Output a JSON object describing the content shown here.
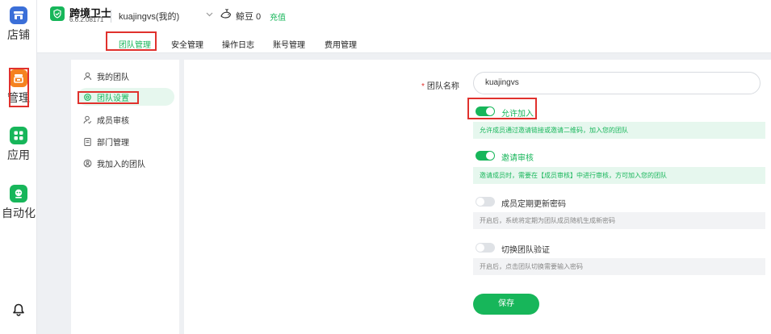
{
  "rail": {
    "items": [
      {
        "label": "店铺",
        "icon": "store-icon"
      },
      {
        "label": "管理",
        "icon": "management-icon"
      },
      {
        "label": "应用",
        "icon": "apps-icon"
      },
      {
        "label": "自动化",
        "icon": "automation-icon"
      }
    ],
    "bottom_icon": "bell-icon"
  },
  "header": {
    "app_name": "跨境卫士",
    "version": "6.6.2.08171",
    "account": "kuajingvs(我的)",
    "beans": "鲸豆 0",
    "recharge": "充值"
  },
  "tabs": [
    "团队管理",
    "安全管理",
    "操作日志",
    "账号管理",
    "费用管理"
  ],
  "subnav": {
    "items": [
      "我的团队",
      "团队设置",
      "成员审核",
      "部门管理",
      "我加入的团队"
    ]
  },
  "form": {
    "name_label": "团队名称",
    "required_mark": "*",
    "name_value": "kuajingvs",
    "options": [
      {
        "label": "允许加入",
        "enabled": true,
        "hint": "允许成员通过邀请链接或邀请二维码，加入您的团队"
      },
      {
        "label": "邀请审核",
        "enabled": true,
        "hint": "邀请成员时，需要在【成员审核】中进行审核，方可加入您的团队"
      },
      {
        "label": "成员定期更新密码",
        "enabled": false,
        "hint": "开启后，系统将定期为团队成员随机生成新密码"
      },
      {
        "label": "切换团队验证",
        "enabled": false,
        "hint": "开启后，点击团队切换需要输入密码"
      }
    ],
    "save_label": "保存"
  },
  "colors": {
    "accent": "#17b65a",
    "highlight_border": "#e0312d",
    "store_icon": "#3b6fd8",
    "management_icon": "#f5821f",
    "apps_icon": "#17b65a",
    "automation_icon": "#17b65a"
  }
}
